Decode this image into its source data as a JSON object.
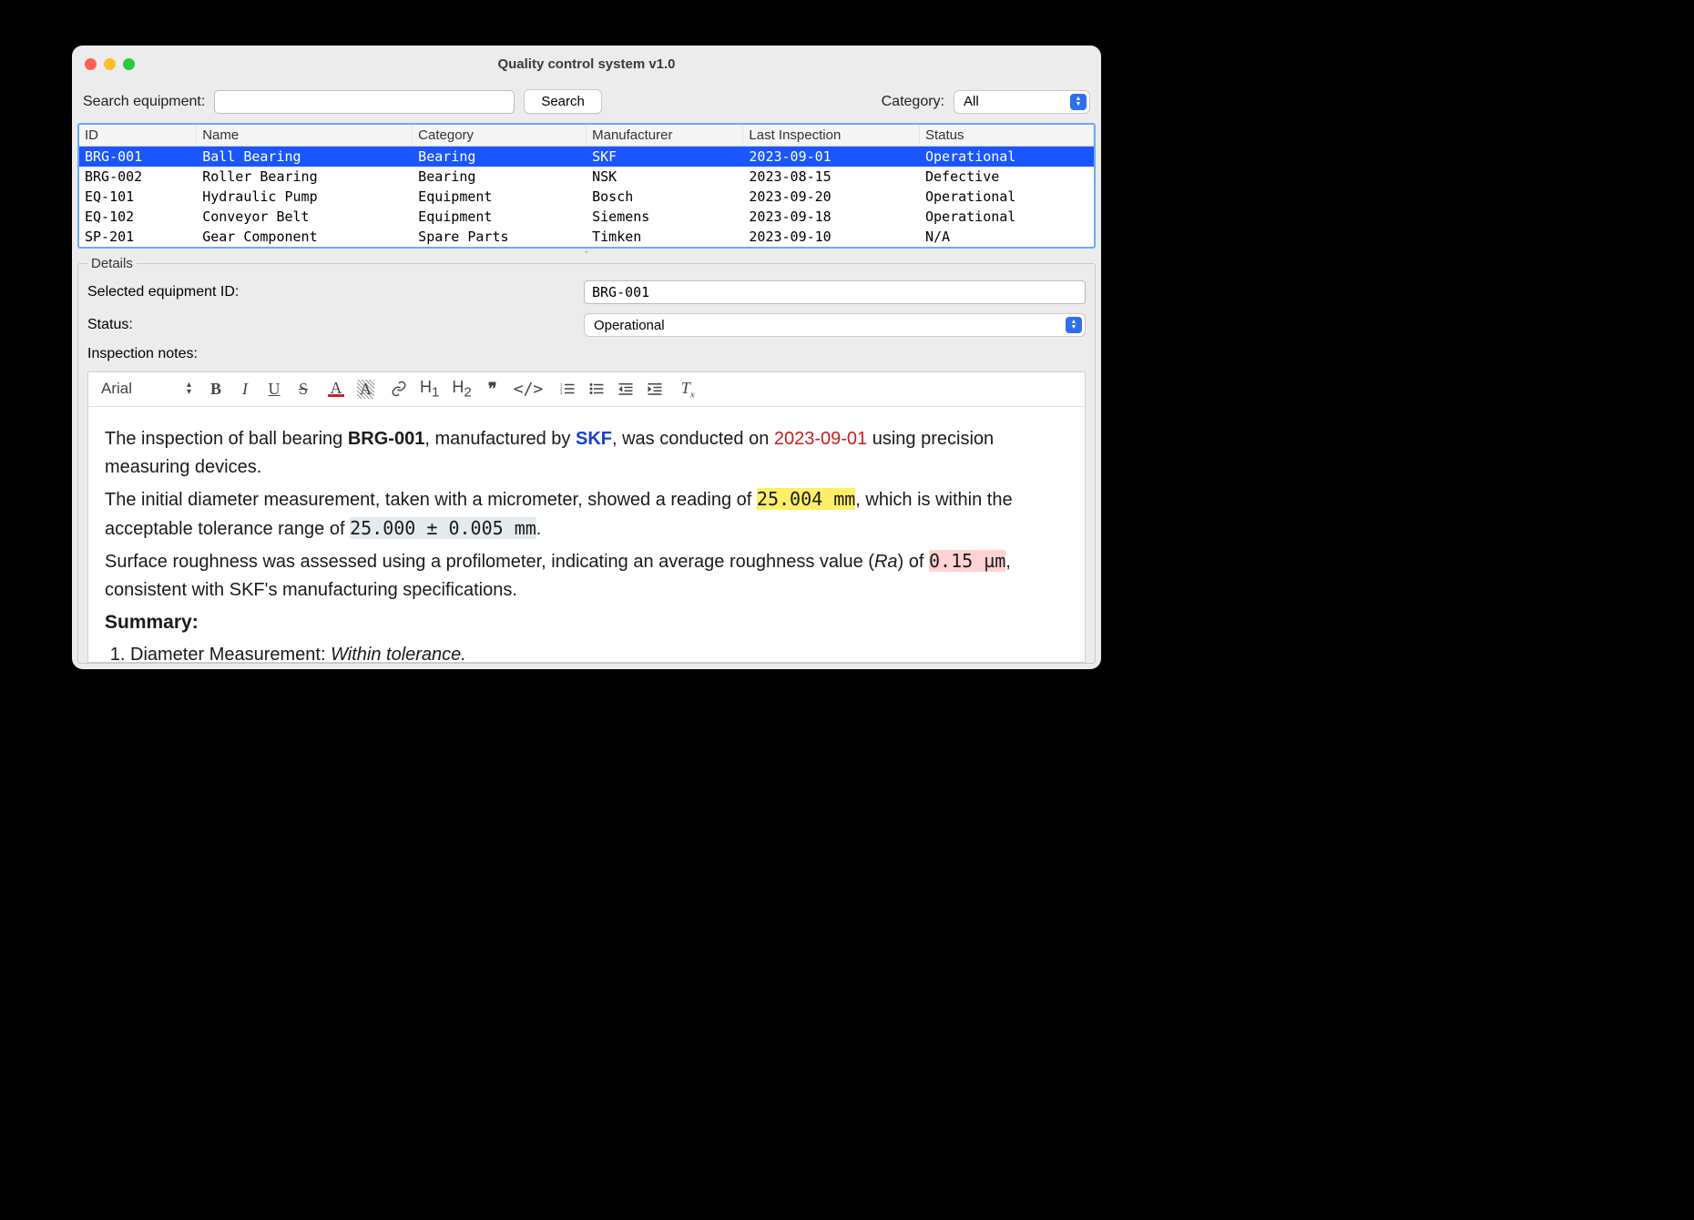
{
  "window": {
    "title": "Quality control system v1.0"
  },
  "toolbar": {
    "search_label": "Search equipment:",
    "search_value": "",
    "search_button": "Search",
    "category_label": "Category:",
    "category_selected": "All"
  },
  "table": {
    "columns": [
      "ID",
      "Name",
      "Category",
      "Manufacturer",
      "Last Inspection",
      "Status"
    ],
    "rows": [
      {
        "id": "BRG-001",
        "name": "Ball Bearing",
        "category": "Bearing",
        "manufacturer": "SKF",
        "last": "2023-09-01",
        "status": "Operational",
        "selected": true
      },
      {
        "id": "BRG-002",
        "name": "Roller Bearing",
        "category": "Bearing",
        "manufacturer": "NSK",
        "last": "2023-08-15",
        "status": "Defective",
        "selected": false
      },
      {
        "id": "EQ-101",
        "name": "Hydraulic Pump",
        "category": "Equipment",
        "manufacturer": "Bosch",
        "last": "2023-09-20",
        "status": "Operational",
        "selected": false
      },
      {
        "id": "EQ-102",
        "name": "Conveyor Belt",
        "category": "Equipment",
        "manufacturer": "Siemens",
        "last": "2023-09-18",
        "status": "Operational",
        "selected": false
      },
      {
        "id": "SP-201",
        "name": "Gear Component",
        "category": "Spare Parts",
        "manufacturer": "Timken",
        "last": "2023-09-10",
        "status": "N/A",
        "selected": false
      }
    ]
  },
  "details": {
    "legend": "Details",
    "selected_id_label": "Selected equipment ID:",
    "selected_id_value": "BRG-001",
    "status_label": "Status:",
    "status_value": "Operational",
    "notes_label": "Inspection notes:"
  },
  "editor": {
    "font": "Arial",
    "heading1": "H",
    "heading1_sub": "1",
    "heading2": "H",
    "heading2_sub": "2",
    "notes": {
      "line1_a": "The inspection of ball bearing ",
      "line1_b": "BRG-001",
      "line1_c": ", manufactured by ",
      "line1_d": "SKF",
      "line1_e": ", was conducted on ",
      "line1_f": "2023-09-01",
      "line1_g": " using precision measuring devices.",
      "line2_a": "The initial diameter measurement, taken with a micrometer, showed a reading of ",
      "line2_b": "25.004 mm",
      "line2_c": ", which is within the acceptable tolerance range of ",
      "line2_d": "25.000 ± 0.005 mm",
      "line2_e": ".",
      "line3_a": "Surface roughness was assessed using a profilometer, indicating an average roughness value (",
      "line3_b": "Ra",
      "line3_c": ") of ",
      "line3_d": "0.15 µm",
      "line3_e": ", consistent with SKF's manufacturing specifications.",
      "summary_h": "Summary:",
      "summary_1a": "Diameter Measurement: ",
      "summary_1b": "Within tolerance."
    }
  }
}
